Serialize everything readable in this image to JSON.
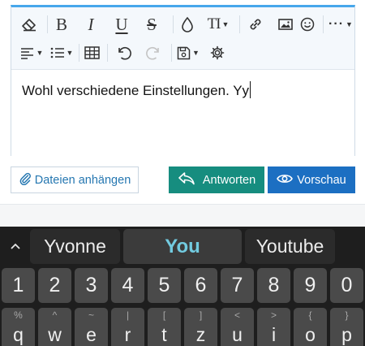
{
  "editor": {
    "toolbar": {
      "row1": [
        "eraser-icon",
        "bold",
        "italic",
        "underline",
        "strikethrough",
        "droplet-icon",
        "text-size",
        "link-icon",
        "image-icon",
        "smiley-icon",
        "more"
      ],
      "row2": [
        "align-icon",
        "list-icon",
        "table-icon",
        "undo-icon",
        "redo-icon",
        "save-draft-icon",
        "gear-icon"
      ],
      "bold_glyph": "B",
      "italic_glyph": "I",
      "underline_glyph": "U",
      "strike_glyph": "S",
      "textsize_glyph": "TI",
      "more_glyph": "···",
      "accent_color": "#47a7eb"
    },
    "content_text": "Wohl verschiedene Einstellungen. Yy"
  },
  "actions": {
    "attach_label": "Dateien anhängen",
    "reply_label": "Antworten",
    "preview_label": "Vorschau",
    "attach_color": "#2577b1",
    "reply_color": "#168d7f",
    "preview_color": "#1c6fc2"
  },
  "keyboard": {
    "suggestions": [
      {
        "text": "Yvonne",
        "selected": false
      },
      {
        "text": "You",
        "selected": true
      },
      {
        "text": "Youtube",
        "selected": false
      }
    ],
    "expand_icon": "chevron-up-icon",
    "number_row": [
      "1",
      "2",
      "3",
      "4",
      "5",
      "6",
      "7",
      "8",
      "9",
      "0"
    ],
    "letter_row": [
      {
        "primary": "q",
        "secondary": "%"
      },
      {
        "primary": "w",
        "secondary": "^"
      },
      {
        "primary": "e",
        "secondary": "~"
      },
      {
        "primary": "r",
        "secondary": "|"
      },
      {
        "primary": "t",
        "secondary": "["
      },
      {
        "primary": "z",
        "secondary": "]"
      },
      {
        "primary": "u",
        "secondary": "<"
      },
      {
        "primary": "i",
        "secondary": ">"
      },
      {
        "primary": "o",
        "secondary": "{"
      },
      {
        "primary": "p",
        "secondary": "}"
      }
    ]
  }
}
